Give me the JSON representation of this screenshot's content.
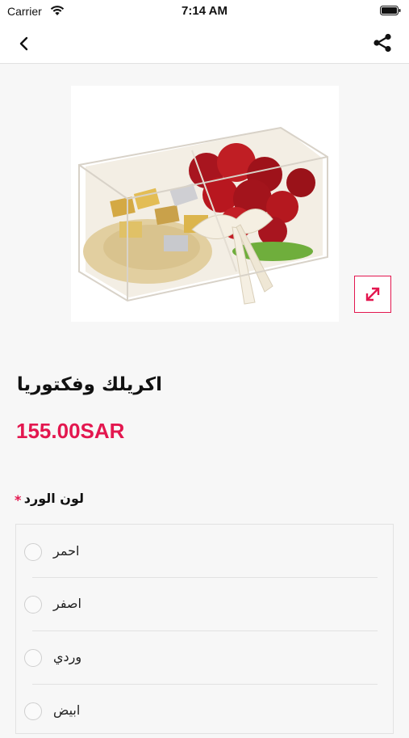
{
  "status_bar": {
    "carrier": "Carrier",
    "time": "7:14 AM"
  },
  "nav": {
    "back_icon": "chevron-left-icon",
    "share_icon": "share-icon"
  },
  "product": {
    "title": "اكريلك وفكتوريا",
    "price": "155.00SAR",
    "expand_icon": "expand-arrows-icon"
  },
  "option_group": {
    "label": "لون الورد",
    "required_mark": "*",
    "options": [
      {
        "label": "احمر"
      },
      {
        "label": "اصفر"
      },
      {
        "label": "وردي"
      },
      {
        "label": "ابيض"
      }
    ]
  },
  "colors": {
    "accent": "#e3174f",
    "background": "#f7f7f7"
  }
}
